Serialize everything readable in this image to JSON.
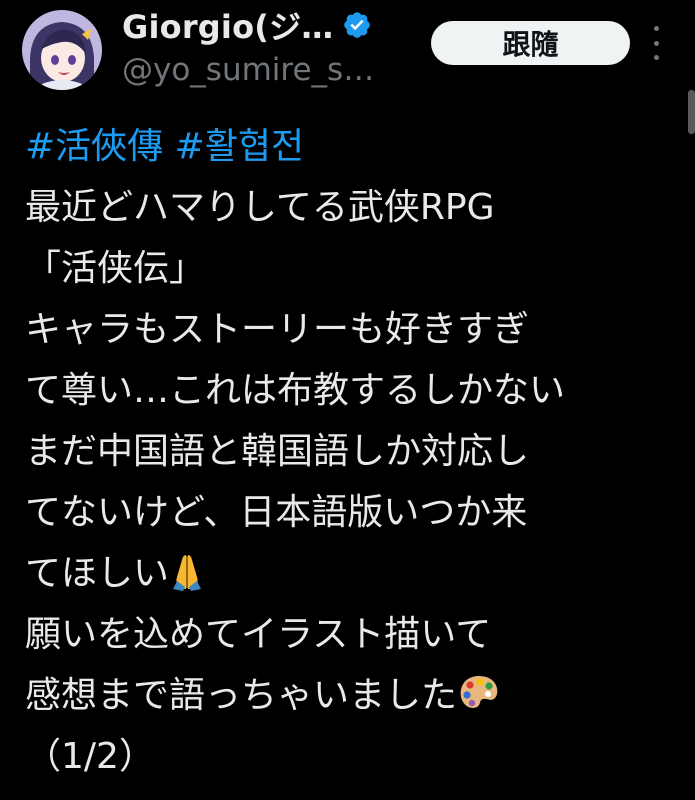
{
  "user": {
    "display_name": "Giorgio(ジ…",
    "handle": "@yo_sumire_s…",
    "verified_icon": "verified-badge-icon",
    "avatar_icon": "anime-girl-avatar"
  },
  "actions": {
    "follow_label": "跟隨",
    "more_icon": "more-vertical-icon"
  },
  "tweet": {
    "hashtags": [
      "#活俠傳",
      "#활협전"
    ],
    "lines": [
      "最近どハマりしてる武侠RPG",
      "「活侠伝」",
      "キャラもストーリーも好きすぎ",
      "て尊い…これは布教するしかない",
      "まだ中国語と韓国語しか対応し",
      "てないけど、日本語版いつか来",
      "てほしい",
      "願いを込めてイラスト描いて",
      "感想まで語っちゃいました",
      "（1/2）"
    ],
    "emojis": {
      "pray": "folded-hands-emoji",
      "palette": "artist-palette-emoji"
    }
  },
  "colors": {
    "background": "#000000",
    "text": "#e7e9ea",
    "secondary_text": "#71767b",
    "link": "#1d9bf0",
    "verified": "#1d9bf0",
    "button_bg": "#eff3f4",
    "button_text": "#0f1419"
  }
}
